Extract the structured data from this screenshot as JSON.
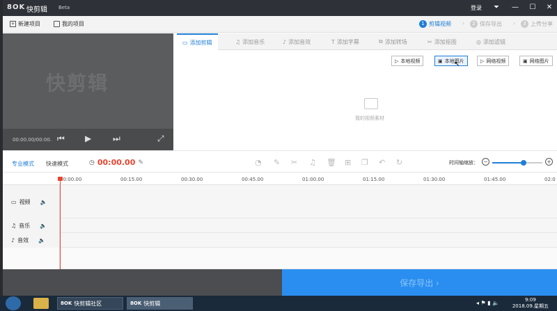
{
  "app": {
    "logo": "8OK",
    "name": "快剪辑",
    "beta": "Beta",
    "login": "登录"
  },
  "toolbar": {
    "new_project": "新建项目",
    "my_projects": "我的项目"
  },
  "steps": [
    {
      "num": "1",
      "label": "剪辑视频"
    },
    {
      "num": "2",
      "label": "保存导出"
    },
    {
      "num": "3",
      "label": "上传分享"
    }
  ],
  "preview": {
    "watermark": "快剪辑",
    "time": "00:00.00/00:00."
  },
  "tabs": [
    {
      "label": "添加剪辑",
      "active": true
    },
    {
      "label": "添加音乐"
    },
    {
      "label": "添加音效"
    },
    {
      "label": "添加字幕"
    },
    {
      "label": "添加转场"
    },
    {
      "label": "添加抠图"
    },
    {
      "label": "添加滤镜"
    }
  ],
  "library": {
    "buttons": [
      "本地视频",
      "本地图片",
      "网络视频",
      "网络图片"
    ],
    "empty_text": "我的视频素材"
  },
  "edit": {
    "mode_pro": "专业模式",
    "mode_fast": "快速模式",
    "timecode": "00:00.00",
    "zoom_label": "时间轴缩放：",
    "zoom_level": 0.62
  },
  "ruler": [
    "00:00.00",
    "00:15.00",
    "00:30.00",
    "00:45.00",
    "01:00.00",
    "01:15.00",
    "01:30.00",
    "01:45.00",
    "02:0"
  ],
  "tracks": {
    "video": "视频",
    "music": "音乐",
    "sound": "音效"
  },
  "export_label": "保存导出 ›",
  "taskbar": {
    "tasks": [
      "快剪辑社区",
      "快剪辑"
    ],
    "time": "9:09",
    "date": "2018.09.星期五"
  }
}
